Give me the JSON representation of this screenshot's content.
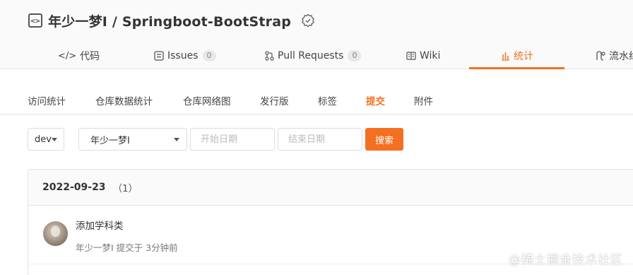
{
  "repo": {
    "title": "年少一梦I / Springboot-BootStrap",
    "code_icon_glyph": "<>"
  },
  "tabs": [
    {
      "label": "代码",
      "icon": "code-icon",
      "glyph": "</>"
    },
    {
      "label": "Issues",
      "icon": "issues-icon",
      "count": "0"
    },
    {
      "label": "Pull Requests",
      "icon": "pull-request-icon",
      "count": "0"
    },
    {
      "label": "Wiki",
      "icon": "wiki-icon"
    },
    {
      "label": "统计",
      "icon": "stats-icon",
      "active": true
    },
    {
      "label": "流水线",
      "icon": "pipeline-icon"
    }
  ],
  "subnav": [
    "访问统计",
    "仓库数据统计",
    "仓库网络图",
    "发行版",
    "标签",
    "提交",
    "附件"
  ],
  "filters": {
    "branch": "dev",
    "author": "年少一梦I",
    "start_placeholder": "开始日期",
    "end_placeholder": "结束日期",
    "search_label": "搜索"
  },
  "commits_group": {
    "date": "2022-09-23",
    "count": "（1）",
    "commits": [
      {
        "message": "添加学科类",
        "meta": "年少一梦I 提交于 3分钟前"
      }
    ]
  },
  "watermark": "@稀土掘金技术社区",
  "colors": {
    "accent": "#f37021",
    "border": "#e3e3e3",
    "header_bg": "#fafafa"
  }
}
